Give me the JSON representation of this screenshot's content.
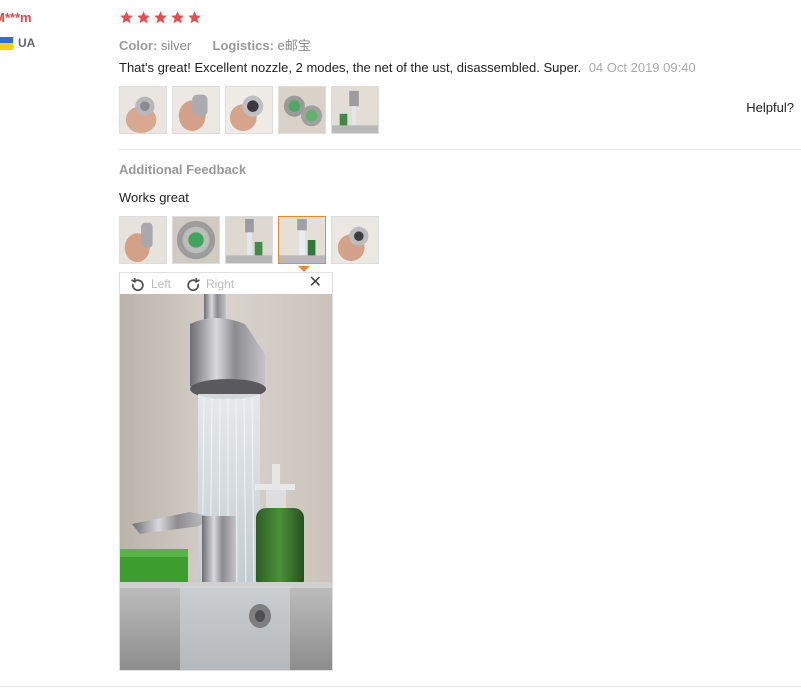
{
  "user": {
    "name": "M***m",
    "country": "UA"
  },
  "review": {
    "rating_stars": 5,
    "star_color": "#e84c4f",
    "color_label": "Color:",
    "color_value": "silver",
    "logistics_label": "Logistics:",
    "logistics_value": "e邮宝",
    "text": "That's great! Excellent nozzle, 2 modes, the net of the ust, disassembled. Super.",
    "date": "04 Oct 2019 09:40",
    "photos": [
      "hand-nozzle-photo",
      "hand-nozzle-side-photo",
      "hand-aerator-photo",
      "aerator-parts-photo",
      "faucet-sink-photo"
    ]
  },
  "helpful_label": "Helpful?",
  "additional_feedback": {
    "title": "Additional Feedback",
    "text": "Works great",
    "photos": [
      "hand-nozzle-photo",
      "aerator-closeup-photo",
      "faucet-soap-photo",
      "faucet-running-photo",
      "hand-nozzle-photo"
    ],
    "active_index": 3
  },
  "viewer": {
    "rotate_left_label": "Left",
    "rotate_right_label": "Right",
    "close_icon": "close-icon",
    "image": "faucet-running-water-with-soap-dispenser"
  },
  "colors": {
    "accent": "#e98a2f",
    "name": "#e0474c"
  }
}
